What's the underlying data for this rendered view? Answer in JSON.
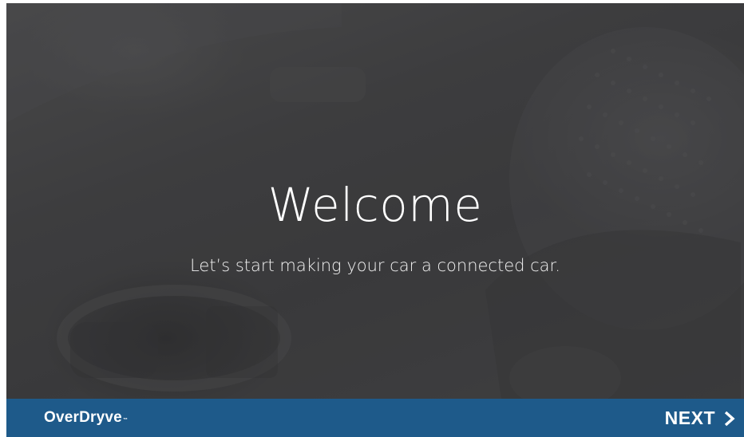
{
  "hero": {
    "title": "Welcome",
    "subtitle": "Let’s start making your car a connected car."
  },
  "footer": {
    "brand": "OverDryve",
    "trademark": "™",
    "next_label": "NEXT",
    "next_icon": "chevron-right-icon"
  },
  "colors": {
    "footer_bg": "#1e5a8a",
    "overlay": "#3c3c3d",
    "text": "#ffffff"
  }
}
